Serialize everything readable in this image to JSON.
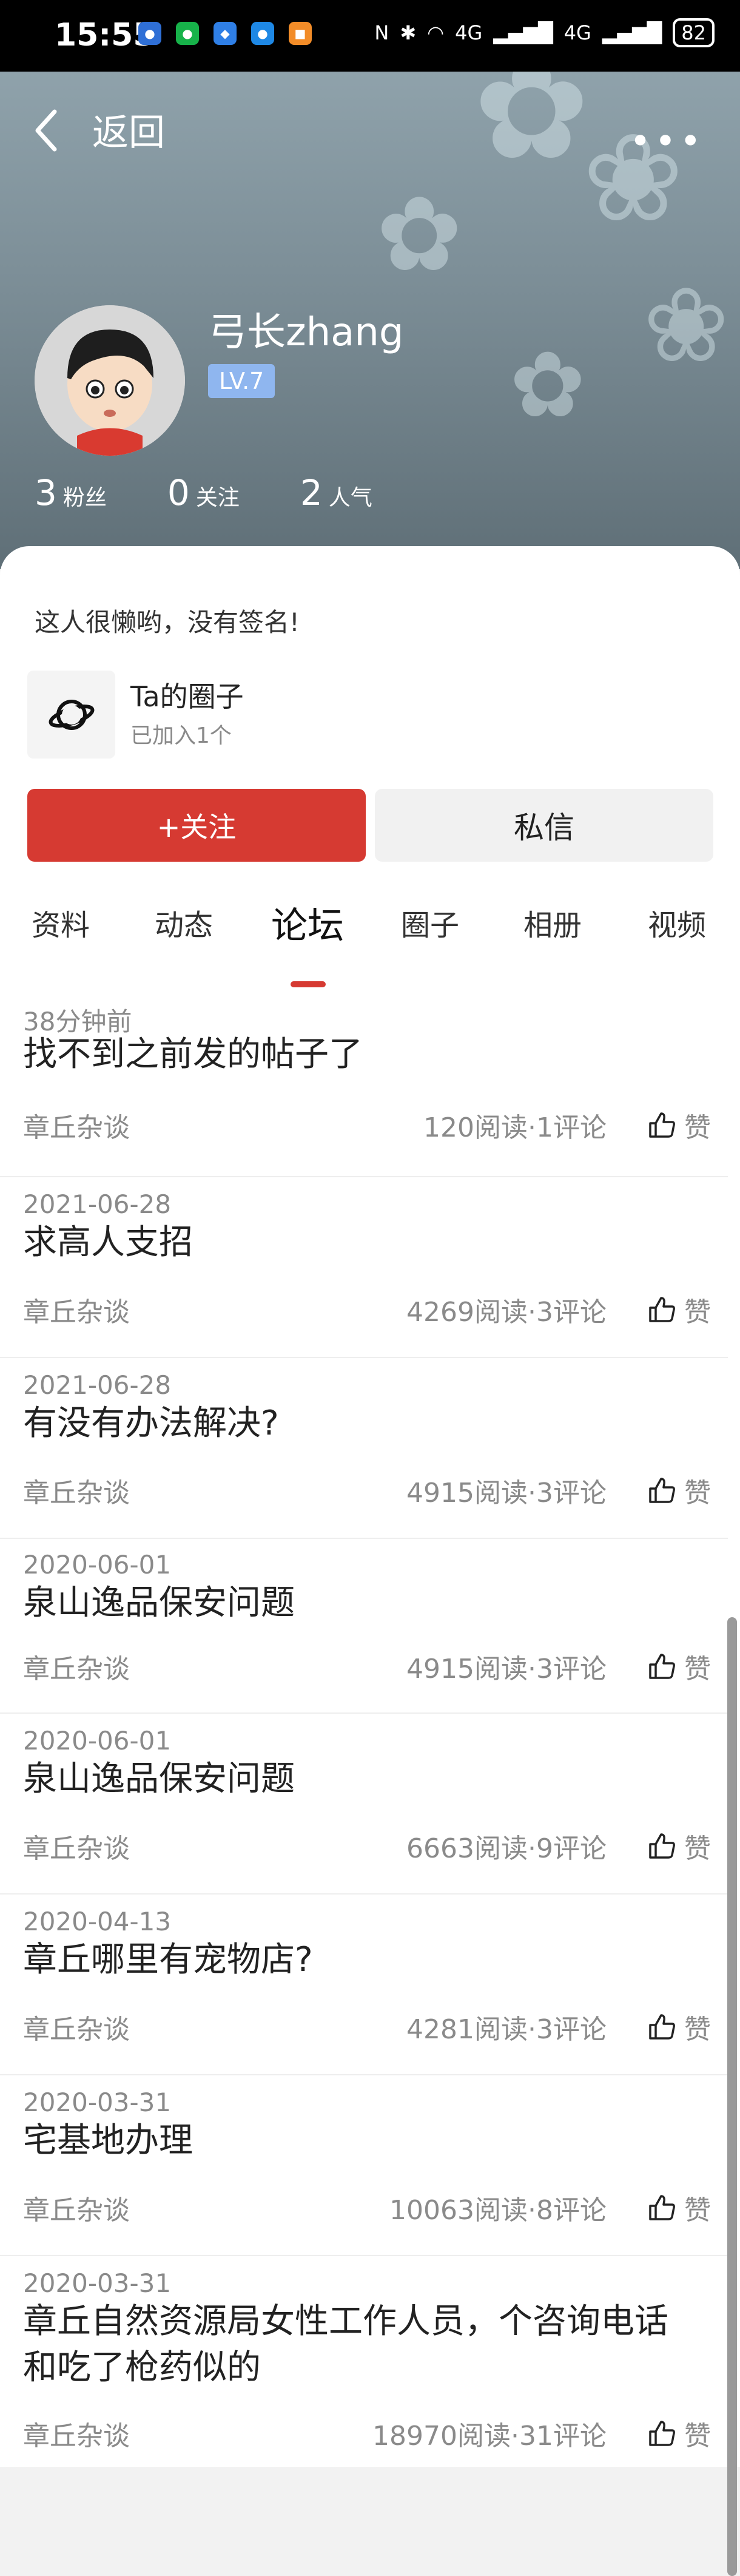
{
  "status_bar": {
    "time": "15:55",
    "battery": "82",
    "network": "4G"
  },
  "header": {
    "back_label": "返回",
    "more_label": "•••"
  },
  "profile": {
    "username": "弓长zhang",
    "level": "LV.7",
    "stats": [
      {
        "num": "3",
        "label": "粉丝"
      },
      {
        "num": "0",
        "label": "关注"
      },
      {
        "num": "2",
        "label": "人气"
      }
    ],
    "signature": "这人很懒哟，没有签名!",
    "circle": {
      "title": "Ta的圈子",
      "subtitle": "已加入1个"
    },
    "follow_label": "+关注",
    "message_label": "私信"
  },
  "tabs": [
    "资料",
    "动态",
    "论坛",
    "圈子",
    "相册",
    "视频"
  ],
  "active_tab": "论坛",
  "posts": [
    {
      "date": "38分钟前",
      "title": "找不到之前发的帖子了",
      "category": "章丘杂谈",
      "stats": "120阅读·1评论",
      "like": "赞"
    },
    {
      "date": "2021-06-28",
      "title": "求高人支招",
      "category": "章丘杂谈",
      "stats": "4269阅读·3评论",
      "like": "赞"
    },
    {
      "date": "2021-06-28",
      "title": "有没有办法解决?",
      "category": "章丘杂谈",
      "stats": "4915阅读·3评论",
      "like": "赞"
    },
    {
      "date": "2020-06-01",
      "title": "泉山逸品保安问题",
      "category": "章丘杂谈",
      "stats": "4915阅读·3评论",
      "like": "赞"
    },
    {
      "date": "2020-06-01",
      "title": "泉山逸品保安问题",
      "category": "章丘杂谈",
      "stats": "6663阅读·9评论",
      "like": "赞"
    },
    {
      "date": "2020-04-13",
      "title": "章丘哪里有宠物店?",
      "category": "章丘杂谈",
      "stats": "4281阅读·3评论",
      "like": "赞"
    },
    {
      "date": "2020-03-31",
      "title": "宅基地办理",
      "category": "章丘杂谈",
      "stats": "10063阅读·8评论",
      "like": "赞"
    },
    {
      "date": "2020-03-31",
      "title": "章丘自然资源局女性工作人员，个咨询电话和吃了枪药似的",
      "category": "章丘杂谈",
      "stats": "18970阅读·31评论",
      "like": "赞"
    }
  ]
}
